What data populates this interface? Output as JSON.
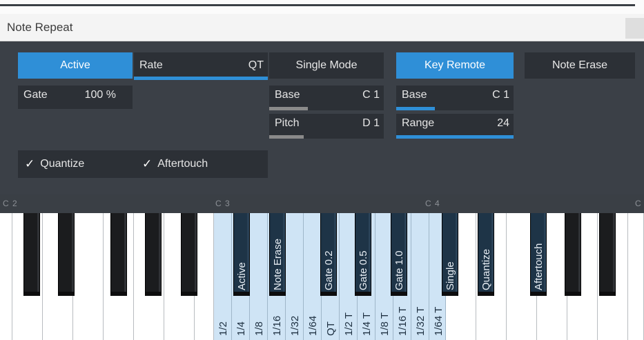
{
  "window": {
    "title": "Note Repeat"
  },
  "controls": {
    "active": "Active",
    "rate": {
      "label": "Rate",
      "value": "QT"
    },
    "single_mode": "Single Mode",
    "key_remote": "Key Remote",
    "note_erase": "Note Erase",
    "gate": {
      "label": "Gate",
      "value": "100 %"
    },
    "single_base": {
      "label": "Base",
      "value": "C 1"
    },
    "single_pitch": {
      "label": "Pitch",
      "value": "D 1"
    },
    "remote_base": {
      "label": "Base",
      "value": "C 1"
    },
    "remote_range": {
      "label": "Range",
      "value": "24"
    },
    "quantize": {
      "label": "Quantize",
      "checked": true
    },
    "aftertouch": {
      "label": "Aftertouch",
      "checked": true
    },
    "checkmark": "✓"
  },
  "keyboard": {
    "note_names": [
      "C 2",
      "C 3",
      "C 4",
      "C"
    ],
    "white_key_labels": [
      "1/2",
      "1/4",
      "1/8",
      "1/16",
      "1/32",
      "1/64",
      "QT",
      "1/2 T",
      "1/4 T",
      "1/8 T",
      "1/16 T",
      "1/32 T",
      "1/64 T"
    ],
    "black_key_labels": [
      "Active",
      "Note Erase",
      "Gate 0.2",
      "Gate 0.5",
      "Gate 1.0",
      "Single",
      "Quantize",
      "Aftertouch"
    ]
  },
  "colors": {
    "accent": "#2f8fd7",
    "panel": "#3b4047",
    "field": "#2c3036",
    "lit_key": "#cfe4f5"
  }
}
